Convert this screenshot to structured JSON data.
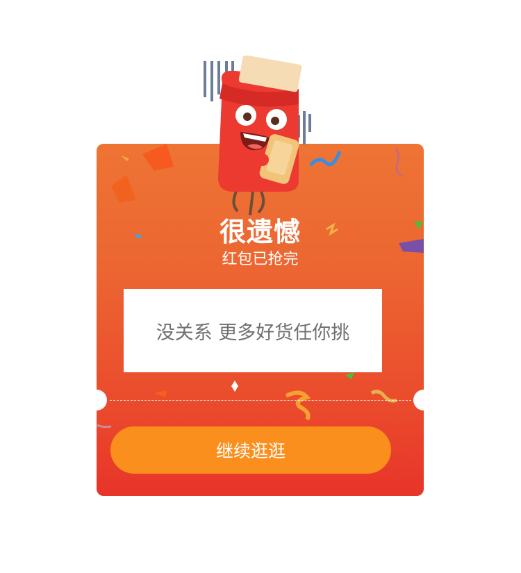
{
  "dialog": {
    "title": "很遗憾",
    "subtitle": "红包已抢完",
    "message": "没关系 更多好货任你挑",
    "button_label": "继续逛逛"
  },
  "colors": {
    "card_top": "#ee7434",
    "card_bottom": "#e8342a",
    "button": "#fb8f1e",
    "message_text": "#707070"
  },
  "icons": [
    "red-envelope-mascot-icon"
  ]
}
